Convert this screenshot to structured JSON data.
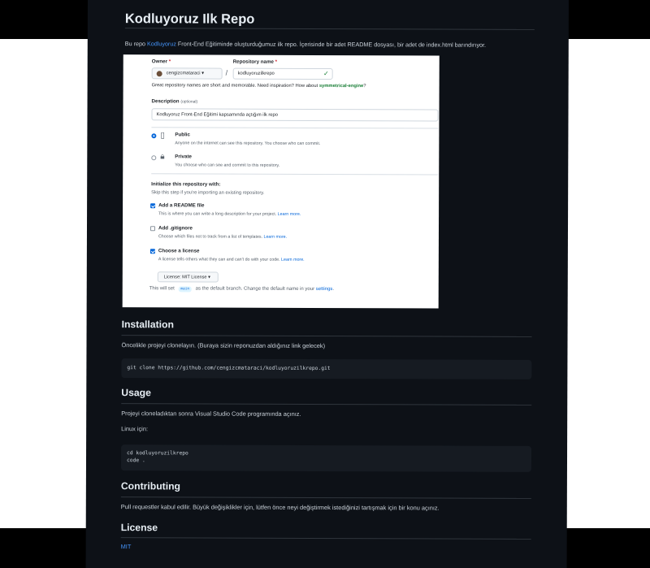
{
  "readme": {
    "title": "Kodluyoruz Ilk Repo",
    "intro_before": "Bu repo ",
    "intro_link": "Kodluyoruz",
    "intro_after": " Front-End Eğitiminde oluşturduğumuz ilk repo. İçerisinde bir adet README dosyası, bir adet de index.html barındırıyor."
  },
  "screenshot": {
    "owner_label": "Owner",
    "repo_label": "Repository name",
    "required_mark": "*",
    "owner_value": "cengizcmataraci ▾",
    "slash": "/",
    "repo_value": "kodluyoruzilkrepo",
    "check": "✓",
    "names_hint": "Great repository names are short and memorable. Need inspiration? How about ",
    "names_suggestion": "symmetrical-engine",
    "names_hint_end": "?",
    "desc_label": "Description",
    "desc_optional": "(optional)",
    "desc_value": "Kodluyoruz Front-End Eğitimi kapsamında açtığım ilk repo",
    "public_label": "Public",
    "public_desc": "Anyone on the internet can see this repository. You choose who can commit.",
    "private_label": "Private",
    "private_desc": "You choose who can see and commit to this repository.",
    "init_title": "Initialize this repository with:",
    "init_desc": "Skip this step if you're importing an existing repository.",
    "readme_label": "Add a README file",
    "readme_desc": "This is where you can write a long description for your project. ",
    "gitignore_label": "Add .gitignore",
    "gitignore_desc": "Choose which files not to track from a list of templates. ",
    "license_label": "Choose a license",
    "license_desc": "A license tells others what they can and can't do with your code. ",
    "learn_more": "Learn more.",
    "license_button": "License: MIT License ▾",
    "branch_before": "This will set ",
    "branch_name": "main",
    "branch_after": " as the default branch. Change the default name in your ",
    "settings_link": "settings",
    "branch_end": "."
  },
  "installation": {
    "heading": "Installation",
    "text": "Öncelikle projeyi clonelayın. (Buraya sizin reponuzdan aldığınız link gelecek)",
    "code": "git clone https://github.com/cengizcmataraci/kodluyoruzilkrepo.git"
  },
  "usage": {
    "heading": "Usage",
    "text": "Projeyi cloneladıktan sonra Visual Studio Code programında açınız.",
    "linux": "Linux için:",
    "code": "cd kodluyoruzilkrepo\ncode ."
  },
  "contributing": {
    "heading": "Contributing",
    "text": "Pull requestler kabul edilir. Büyük değişiklikler için, lütfen önce neyi değiştirmek istediğinizi tartışmak için bir konu açınız."
  },
  "license": {
    "heading": "License",
    "link": "MIT"
  },
  "colors": {
    "background": "#0d1117",
    "text": "#c9d1d9",
    "link": "#4493f8",
    "code_bg": "#161b22"
  }
}
